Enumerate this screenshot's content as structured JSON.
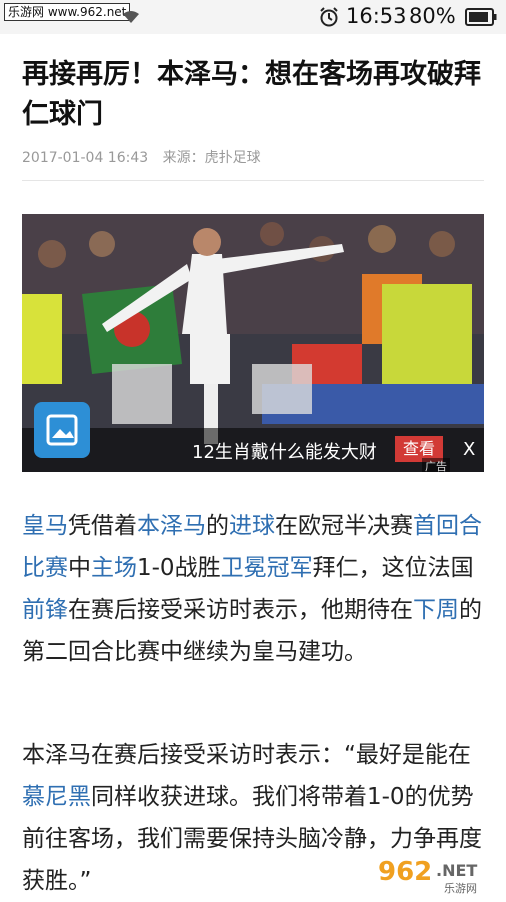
{
  "status_bar": {
    "watermark": "乐游网 www.962.net",
    "time": "16:53",
    "battery": "80%"
  },
  "article": {
    "title": "再接再厉！本泽马：想在客场再攻破拜仁球门",
    "date": "2017-01-04 16:43",
    "source": "来源：虎扑足球"
  },
  "ad": {
    "text": "12生肖戴什么能发大财",
    "button": "查看",
    "tag": "广告",
    "close": "X"
  },
  "paragraph1": {
    "s1": "皇马",
    "s2": "凭借着",
    "s3": "本泽马",
    "s4": "的",
    "s5": "进球",
    "s6": "在欧冠半决赛",
    "s7": "首回合比赛",
    "s8": "中",
    "s9": "主场",
    "s10": "1-0战胜",
    "s11": "卫冕冠军",
    "s12": "拜仁，这位法国",
    "s13": "前锋",
    "s14": "在赛后接受采访时表示，他期待在",
    "s15": "下周",
    "s16": "的第二回合比赛中继续为皇马建功。"
  },
  "paragraph2": {
    "s1": "本泽马在赛后接受采访时表示：“最好是能在",
    "s2": "慕尼黑",
    "s3": "同样收获进球。我们将带着1-0的优势前往客场，我们需要保持头脑冷静，力争再度获胜。”"
  },
  "watermark_logo": {
    "digits": "962",
    "suffix": ".NET",
    "sub": "乐游网"
  }
}
